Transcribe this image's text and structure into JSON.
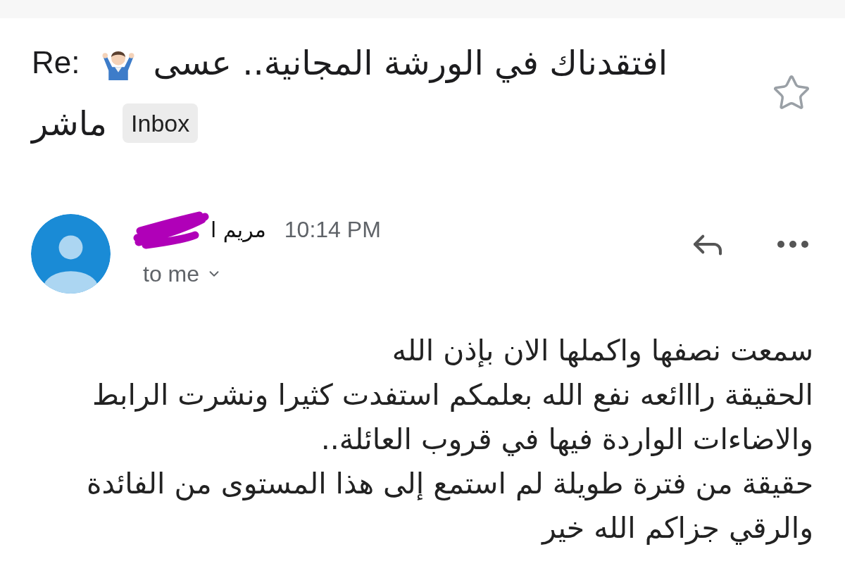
{
  "subject": {
    "prefix": "Re:",
    "lines": [
      "افتقدناك في الورشة المجانية.. عسى",
      "ماشر"
    ],
    "label": "Inbox",
    "starred": false
  },
  "message": {
    "sender": "مريم ا",
    "time": "10:14 PM",
    "recipient": "to me"
  },
  "body": [
    "سمعت نصفها واكملها الان بإذن الله",
    "الحقيقة رااائعه نفع الله بعلمكم استفدت كثيرا ونشرت الرابط",
    "والاضاءات الواردة فيها في قروب العائلة..",
    "حقيقة من فترة طويلة لم استمع إلى هذا المستوى من الفائدة",
    "والرقي جزاكم الله خير"
  ]
}
